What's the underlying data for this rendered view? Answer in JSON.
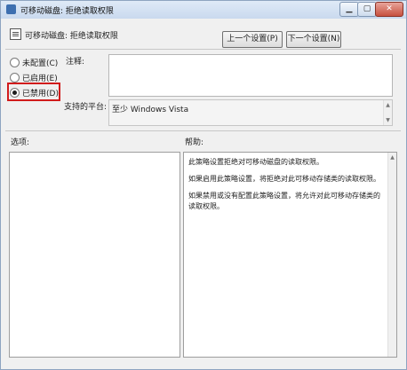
{
  "window": {
    "title": "可移动磁盘: 拒绝读取权限",
    "min_glyph": "▁",
    "max_glyph": "▢",
    "close_glyph": "✕"
  },
  "header": {
    "subtitle": "可移动磁盘: 拒绝读取权限",
    "prev_button": "上一个设置(P)",
    "next_button": "下一个设置(N)"
  },
  "state": {
    "options": [
      {
        "label": "未配置(C)",
        "selected": false
      },
      {
        "label": "已启用(E)",
        "selected": false
      },
      {
        "label": "已禁用(D)",
        "selected": true
      }
    ]
  },
  "comment": {
    "label": "注释:",
    "value": ""
  },
  "platform": {
    "label": "支持的平台:",
    "value": "至少 Windows Vista"
  },
  "panels": {
    "options_label": "选项:",
    "help_label": "帮助:"
  },
  "help": {
    "paragraphs": [
      "此策略设置拒绝对可移动磁盘的读取权限。",
      "如果启用此策略设置，将拒绝对此可移动存储类的读取权限。",
      "如果禁用或没有配置此策略设置，将允许对此可移动存储类的读取权限。"
    ]
  },
  "icons": {
    "title_icon": "policy-icon",
    "subtitle_icon": "settings-page-icon",
    "scroll_up": "▲",
    "scroll_down": "▼"
  },
  "colors": {
    "highlight": "#d11b1b",
    "titlebar": "#c9d9ee",
    "close_button": "#c7503f"
  }
}
